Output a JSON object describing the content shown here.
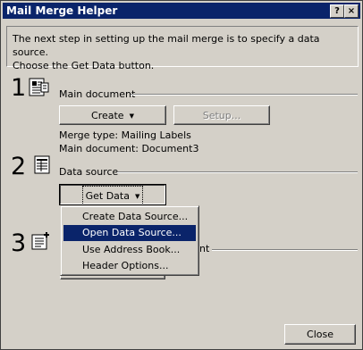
{
  "window": {
    "title": "Mail Merge Helper",
    "help_button": "?",
    "close_button": "×"
  },
  "intro": {
    "line1": "The next step in setting up the mail merge is to specify a data source.",
    "line2": "Choose the Get Data button."
  },
  "steps": [
    {
      "number": "1",
      "label": "Main document",
      "buttons": {
        "create": "Create",
        "setup": "Setup..."
      },
      "merge_type": "Merge type: Mailing Labels",
      "main_document": "Main document: Document3"
    },
    {
      "number": "2",
      "label": "Data source",
      "buttons": {
        "get_data": "Get Data"
      }
    },
    {
      "number": "3",
      "label_visible_tail": "nt"
    }
  ],
  "dropdown_menu": {
    "items": [
      {
        "label": "Create Data Source...",
        "highlighted": false
      },
      {
        "label": "Open Data Source...",
        "highlighted": true
      },
      {
        "label": "Use Address Book...",
        "highlighted": false
      },
      {
        "label": "Header Options...",
        "highlighted": false
      }
    ]
  },
  "footer": {
    "close_label": "Close"
  },
  "colors": {
    "face": "#d4d0c8",
    "titlebar": "#0a246a",
    "highlight": "#0a246a",
    "disabled_text": "#808080"
  }
}
